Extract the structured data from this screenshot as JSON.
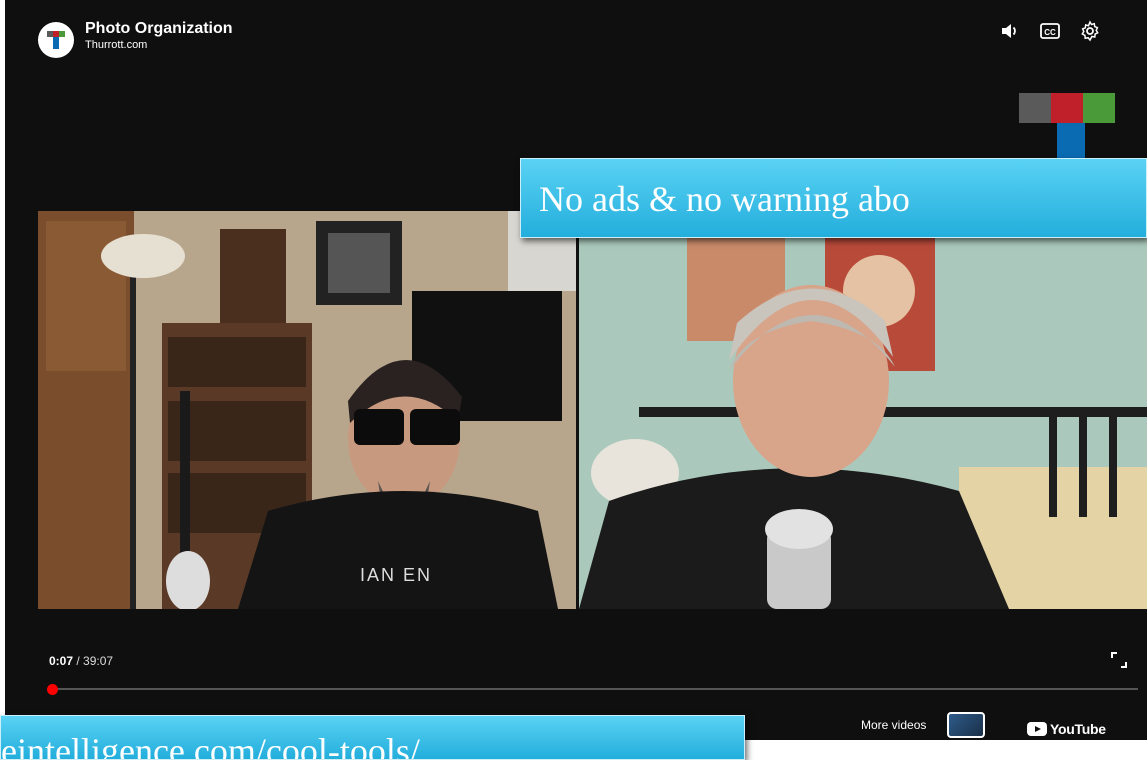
{
  "header": {
    "title": "Photo Organization",
    "channel": "Thurrott.com",
    "icons": [
      "volume-icon",
      "captions-icon",
      "settings-icon"
    ]
  },
  "overlay": {
    "top_text": "No ads & no warning abo",
    "bottom_text": "eintelligence.com/cool-tools/"
  },
  "controls": {
    "current_time": "0:07",
    "separator": " / ",
    "duration": "39:07",
    "progress_fraction": 0.003,
    "more_videos_label": "More videos",
    "youtube_label": "YouTube"
  },
  "video": {
    "shirt_text": "IAN EN"
  },
  "colors": {
    "accent_blue": "#23aedc",
    "progress_red": "#ff0000",
    "logo_gray": "#5a5a5a",
    "logo_red": "#c0202a",
    "logo_green": "#4a9a3a",
    "logo_blue": "#0a6bb3"
  }
}
